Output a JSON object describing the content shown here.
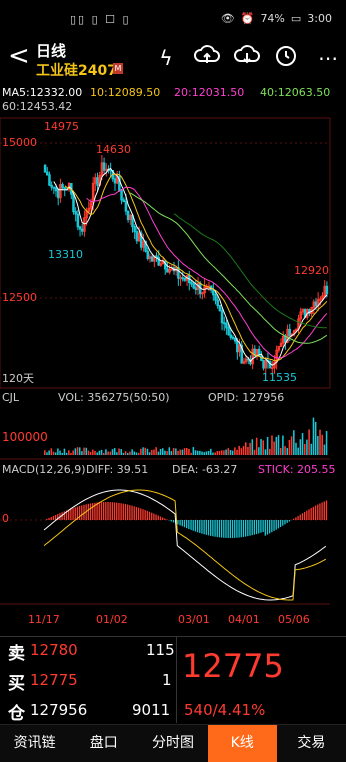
{
  "status": {
    "left_icons": "▯▯ ▯ ☐ ▯",
    "right": "👁 ⚠ 74% ▭ 3:00",
    "battery": "74%",
    "time": "3:00"
  },
  "header": {
    "back": "<",
    "period": "日线",
    "instrument": "工业硅2407",
    "badge": "M"
  },
  "toolbar": {
    "icons": [
      "flash-icon",
      "cloud-upload-icon",
      "cloud-download-icon",
      "clock-icon",
      "more-icon"
    ]
  },
  "ma": {
    "ma5": "MA5:12332.00",
    "ma10": "10:12089.50",
    "ma20": "20:12031.50",
    "ma40": "40:12063.50",
    "ma60": "60:12453.42"
  },
  "price_labels": {
    "y1": "15000",
    "y2": "12500",
    "high": "14975",
    "high2": "14630",
    "low1": "13310",
    "last_high": "12920",
    "low2": "11535",
    "days": "120天"
  },
  "cjl": {
    "title": "CJL",
    "vol": "VOL: 356275(50:50)",
    "opid": "OPID: 127956",
    "y": "100000"
  },
  "macd": {
    "title": "MACD(12,26,9)",
    "diff": "DIFF: 39.51",
    "dea": "DEA: -63.27",
    "stick": "STICK: 205.55",
    "zero": "0"
  },
  "dates": [
    "11/17",
    "01/02",
    "03/01",
    "04/01",
    "05/06"
  ],
  "quotes": {
    "sell_label": "卖",
    "sell_price": "12780",
    "sell_qty": "115",
    "buy_label": "买",
    "buy_price": "12775",
    "buy_qty": "1",
    "oi_label": "仓",
    "oi": "127956",
    "oi_change": "9011",
    "last": "12775",
    "change": "540/4.41%"
  },
  "tabs": [
    "资讯链",
    "盘口",
    "分时图",
    "K线",
    "交易"
  ],
  "colors": {
    "up": "#ff3b30",
    "down": "#19c7d6",
    "ma5": "#ffffff",
    "ma10": "#f5c518",
    "ma20": "#ff3fd1",
    "ma40": "#7ee15b"
  },
  "chart_data": {
    "type": "candlestick",
    "note": "price-series",
    "close_approx": [
      14500,
      14200,
      14300,
      13600,
      14200,
      14600,
      14400,
      13900,
      13500,
      13200,
      13200,
      13000,
      12900,
      12800,
      12700,
      12400,
      12000,
      11700,
      11800,
      11600,
      11900,
      12200,
      12400,
      12600,
      12775
    ]
  }
}
